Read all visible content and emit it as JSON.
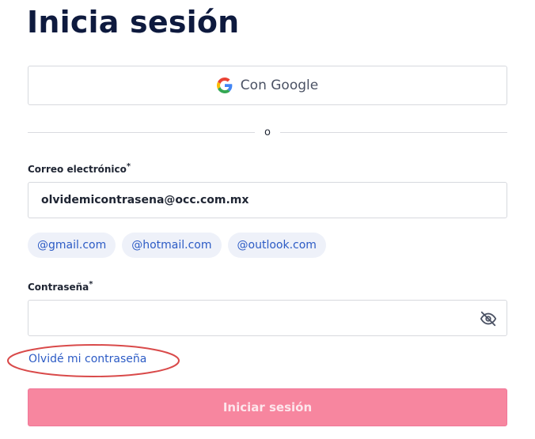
{
  "page": {
    "title": "Inicia sesión"
  },
  "google": {
    "label": "Con Google",
    "icon": "google-logo-icon"
  },
  "divider": {
    "text": "o"
  },
  "email": {
    "label": "Correo electrónico",
    "required_mark": "*",
    "value": "olvidemicontrasena@occ.com.mx"
  },
  "suggestions": [
    "@gmail.com",
    "@hotmail.com",
    "@outlook.com"
  ],
  "password": {
    "label": "Contraseña",
    "required_mark": "*",
    "value": "",
    "toggle_icon": "eye-slash-icon"
  },
  "forgot": {
    "label": "Olvidé mi contraseña"
  },
  "submit": {
    "label": "Iniciar sesión"
  },
  "colors": {
    "title": "#0e1a3e",
    "link": "#2c5bc5",
    "submit_bg": "#f7869f",
    "annotation": "#d94a4a"
  }
}
